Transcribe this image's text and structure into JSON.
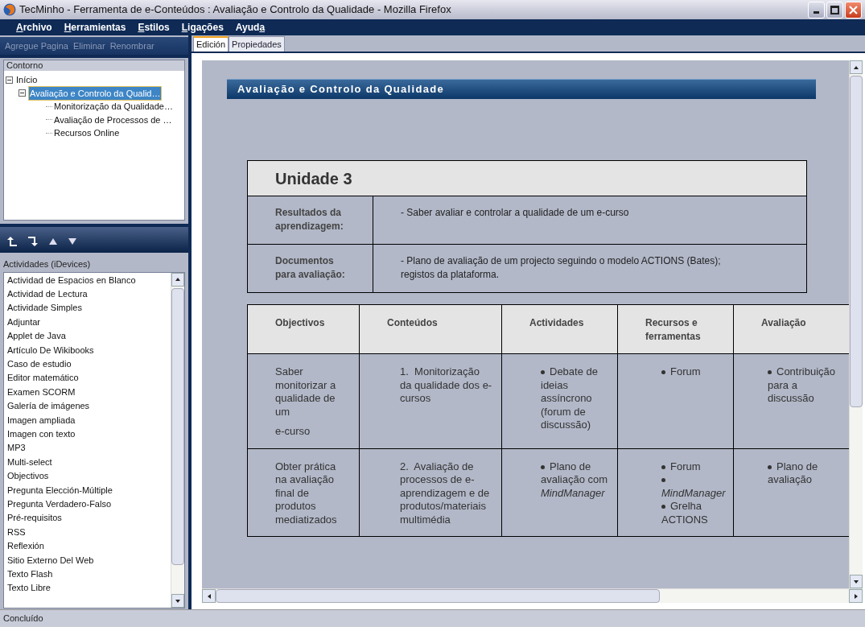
{
  "window": {
    "title": "TecMinho - Ferramenta de e-Conteúdos : Avaliação e Controlo da Qualidade - Mozilla Firefox"
  },
  "menu": [
    {
      "key": "A",
      "rest": "rchivo"
    },
    {
      "key": "H",
      "rest": "erramientas"
    },
    {
      "key": "E",
      "rest": "stilos"
    },
    {
      "key": "L",
      "rest": "igações"
    },
    {
      "key": "a",
      "before": "Ayud"
    }
  ],
  "page_toolbar": [
    {
      "label": "Agregue Pagina",
      "disabled": true
    },
    {
      "label": "Eliminar",
      "disabled": true
    },
    {
      "label": "Renombrar",
      "disabled": true
    }
  ],
  "outline": {
    "title": "Contorno",
    "items": [
      {
        "label": "Início",
        "expanded": true,
        "selected": false,
        "children": [
          {
            "label": "Avaliação e Controlo da Qualid…",
            "expanded": true,
            "selected": true,
            "children": [
              {
                "label": "Monitorização da Qualidade…",
                "selected": false
              },
              {
                "label": "Avaliação de Processos de …",
                "selected": false
              },
              {
                "label": "Recursos Online",
                "selected": false
              }
            ]
          }
        ]
      }
    ]
  },
  "idevices": {
    "title": "Actividades (iDevices)",
    "items": [
      "Actividad de Espacios en Blanco",
      "Actividad de Lectura",
      "Actividade Simples",
      "Adjuntar",
      "Applet de Java",
      "Artículo De Wikibooks",
      "Caso de estudio",
      "Editor matemático",
      "Examen SCORM",
      "Galería de imágenes",
      "Imagen ampliada",
      "Imagen con texto",
      "MP3",
      "Multi-select",
      "Objectivos",
      "Pregunta Elección-Múltiple",
      "Pregunta Verdadero-Falso",
      "Pré-requisitos",
      "RSS",
      "Reflexión",
      "Sitio Externo Del Web",
      "Texto Flash",
      "Texto Libre"
    ]
  },
  "tabs": [
    {
      "label": "Edición",
      "selected": true
    },
    {
      "label": "Propiedades",
      "selected": false
    }
  ],
  "document": {
    "heading": "Avaliação e Controlo da Qualidade",
    "unit_table": {
      "title": "Unidade 3",
      "rows": [
        {
          "label": "Resultados da aprendizagem:",
          "lines": [
            "- Saber avaliar e controlar a qualidade de um e-curso"
          ]
        },
        {
          "label": "Documentos para avaliação:",
          "lines": [
            "- Plano de avaliação de um projecto seguindo o modelo ACTIONS (Bates);",
            "registos da plataforma."
          ]
        }
      ]
    },
    "plan_table": {
      "columns": [
        "Objectivos",
        "Conteúdos",
        "Actividades",
        "Recursos e ferramentas",
        "Avaliação"
      ],
      "rows": [
        {
          "cells": [
            {
              "kind": "text",
              "paragraphs": [
                "Saber monitorizar a qualidade de um",
                "e-curso"
              ]
            },
            {
              "kind": "numbered",
              "number": "1.",
              "text": "Monitorização da qualidade dos e-cursos"
            },
            {
              "kind": "bullets",
              "items": [
                "Debate de ideias assíncrono (forum de discussão)"
              ]
            },
            {
              "kind": "bullets",
              "items": [
                "Forum"
              ]
            },
            {
              "kind": "bullets",
              "items": [
                "Contribuição para a discussão"
              ]
            }
          ]
        },
        {
          "cells": [
            {
              "kind": "text",
              "paragraphs": [
                "Obter prática na avaliação final de produtos mediatizados"
              ]
            },
            {
              "kind": "numbered",
              "number": "2.",
              "text": "Avaliação de processos de e-aprendizagem e de produtos/materiais multimédia"
            },
            {
              "kind": "bullets",
              "items": [
                "Plano de avaliação com *MindManager*"
              ]
            },
            {
              "kind": "bullets",
              "items": [
                "Forum",
                "*MindManager*",
                "Grelha ACTIONS"
              ]
            },
            {
              "kind": "bullets",
              "items": [
                "Plano de avaliação"
              ]
            }
          ]
        }
      ]
    }
  },
  "status_bar": "Concluído"
}
